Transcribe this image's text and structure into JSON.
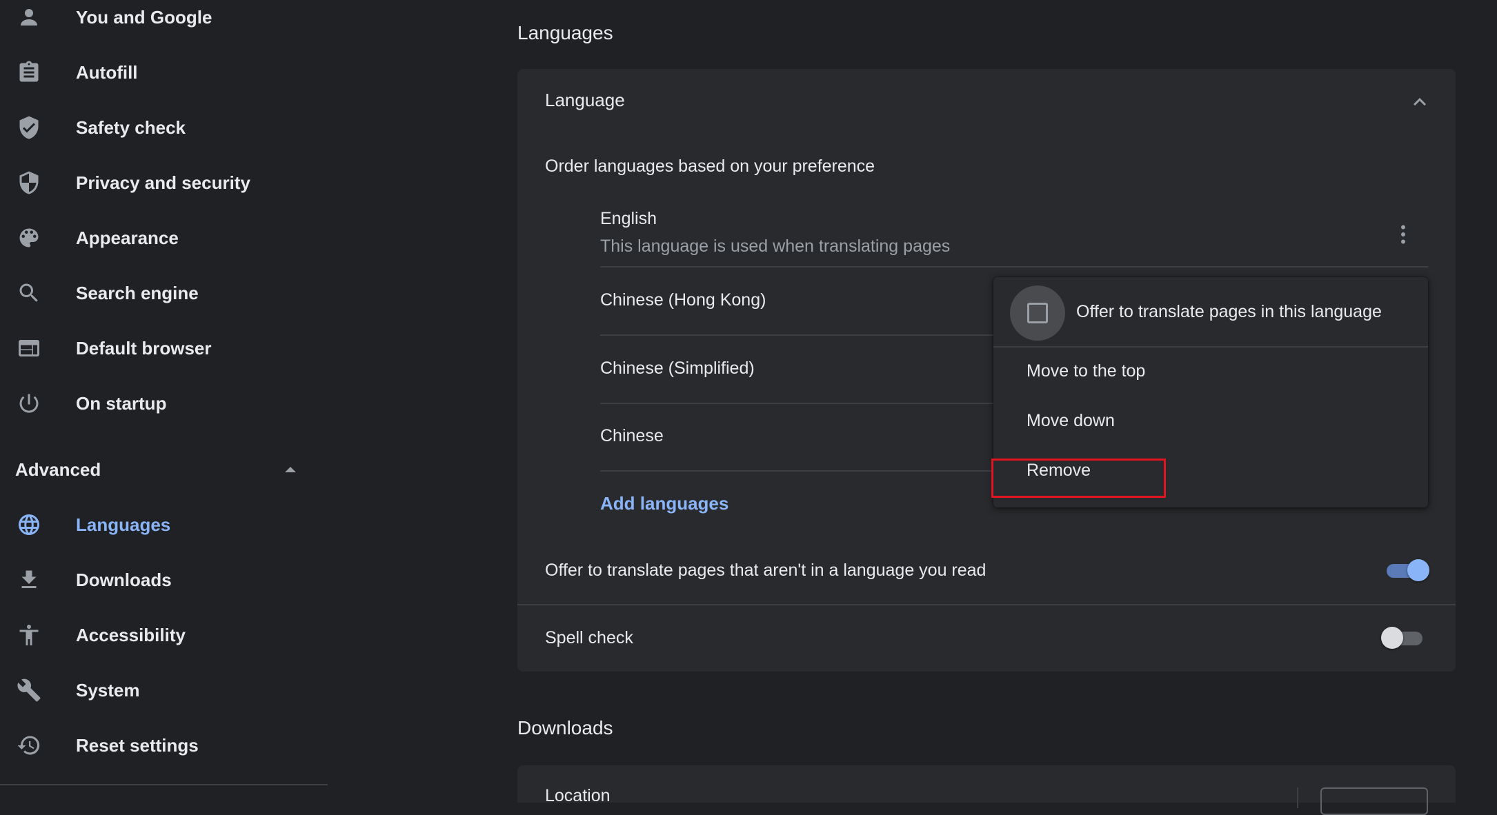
{
  "sidebar": {
    "items": [
      {
        "label": "You and Google",
        "icon": "person-icon"
      },
      {
        "label": "Autofill",
        "icon": "clipboard-icon"
      },
      {
        "label": "Safety check",
        "icon": "shield-check-icon"
      },
      {
        "label": "Privacy and security",
        "icon": "shield-half-icon"
      },
      {
        "label": "Appearance",
        "icon": "palette-icon"
      },
      {
        "label": "Search engine",
        "icon": "search-icon"
      },
      {
        "label": "Default browser",
        "icon": "browser-window-icon"
      },
      {
        "label": "On startup",
        "icon": "power-icon"
      }
    ],
    "advanced_label": "Advanced",
    "advanced_items": [
      {
        "label": "Languages",
        "icon": "globe-icon",
        "active": true
      },
      {
        "label": "Downloads",
        "icon": "download-icon"
      },
      {
        "label": "Accessibility",
        "icon": "accessibility-icon"
      },
      {
        "label": "System",
        "icon": "wrench-icon"
      },
      {
        "label": "Reset settings",
        "icon": "restore-icon"
      }
    ]
  },
  "main": {
    "languages_section_title": "Languages",
    "language_card": {
      "header": "Language",
      "order_text": "Order languages based on your preference",
      "languages": [
        {
          "name": "English",
          "subtext": "This language is used when translating pages"
        },
        {
          "name": "Chinese (Hong Kong)"
        },
        {
          "name": "Chinese (Simplified)"
        },
        {
          "name": "Chinese"
        }
      ],
      "add_languages_label": "Add languages",
      "offer_translate_label": "Offer to translate pages that aren't in a language you read",
      "offer_translate_on": true,
      "spell_check_label": "Spell check",
      "spell_check_on": false
    },
    "downloads_section_title": "Downloads",
    "downloads_card": {
      "location_label": "Location"
    }
  },
  "context_menu": {
    "offer_translate_item": "Offer to translate pages in this language",
    "offer_translate_checked": false,
    "move_top": "Move to the top",
    "move_down": "Move down",
    "remove": "Remove"
  },
  "colors": {
    "background": "#202124",
    "card": "#292a2d",
    "accent": "#8ab4f8",
    "highlight_box": "#e0141e"
  }
}
